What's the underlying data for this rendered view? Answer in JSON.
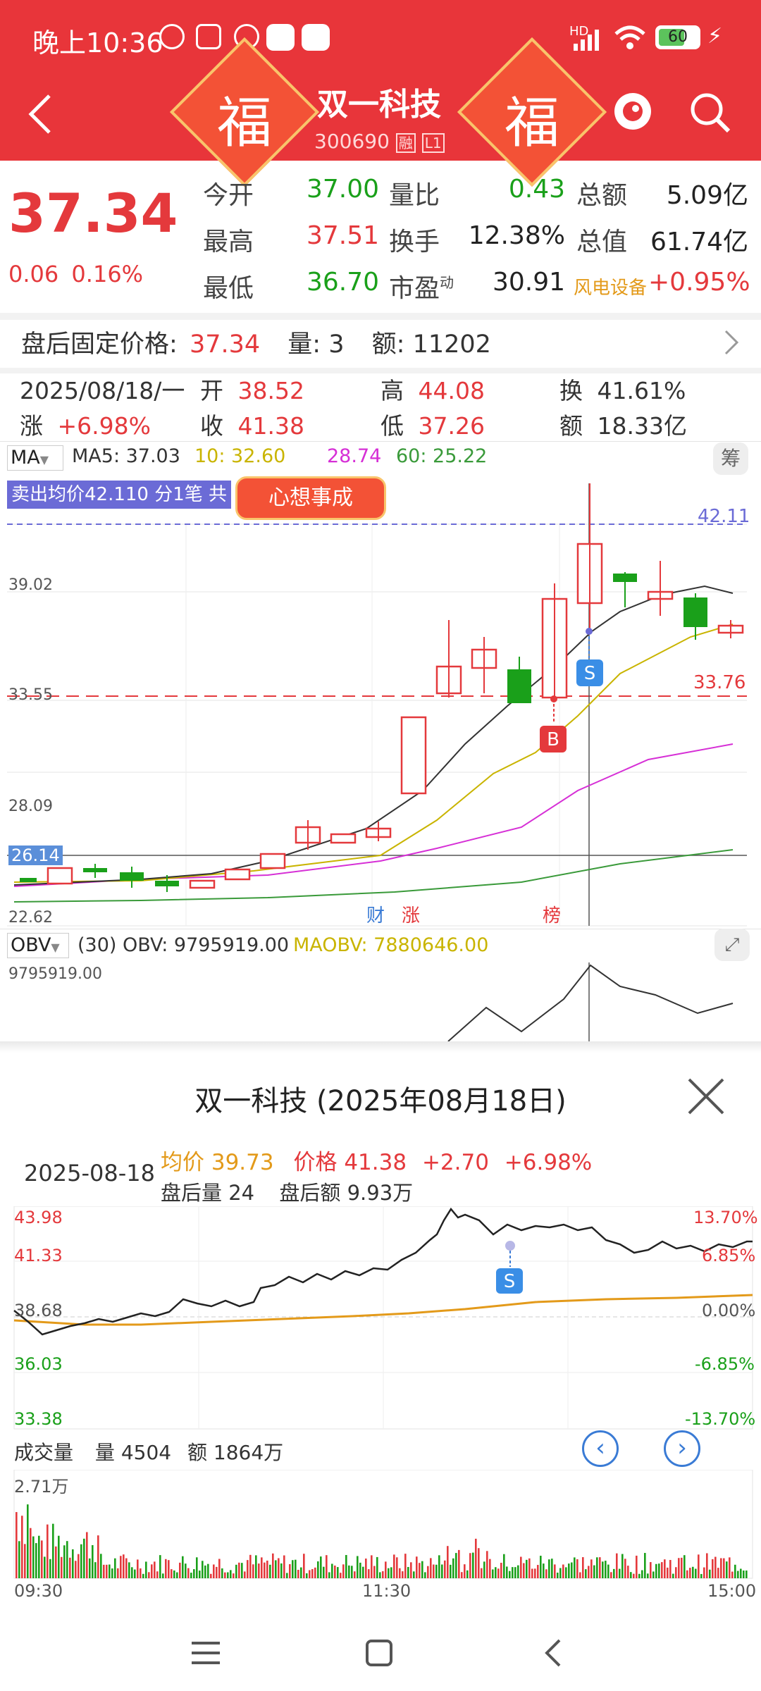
{
  "status_bar": {
    "time": "晚上10:36",
    "battery": "60",
    "network": "HD"
  },
  "nav": {
    "title": "双一科技",
    "code": "300690",
    "tag_rong": "融",
    "tag_level": "L1",
    "fu_char": "福"
  },
  "quote": {
    "price": "37.34",
    "change": "0.06",
    "change_pct": "0.16%",
    "items": [
      {
        "label": "今开",
        "value": "37.00"
      },
      {
        "label": "最高",
        "value": "37.51"
      },
      {
        "label": "最低",
        "value": "36.70"
      },
      {
        "label": "量比",
        "value": "0.43"
      },
      {
        "label": "换手",
        "value": "12.38%"
      },
      {
        "label": "市盈",
        "value": "30.91",
        "sup": "动"
      },
      {
        "label": "总额",
        "value": "5.09亿"
      },
      {
        "label": "总值",
        "value": "61.74亿"
      },
      {
        "label": "风电设备",
        "value": "+0.95%"
      }
    ]
  },
  "after_hours": {
    "label": "盘后固定价格:",
    "price": "37.34",
    "vol_label": "量:",
    "vol": "3",
    "amt_label": "额:",
    "amt": "11202"
  },
  "day_info": {
    "date": "2025/08/18/一",
    "open_label": "开",
    "open": "38.52",
    "high_label": "高",
    "high": "44.08",
    "turnover_label": "换",
    "turnover": "41.61%",
    "change_label": "涨",
    "change": "+6.98%",
    "close_label": "收",
    "close": "41.38",
    "low_label": "低",
    "low": "37.26",
    "amount_label": "额",
    "amount": "18.33亿"
  },
  "indicators": {
    "ma_selector": "MA",
    "ma5": "MA5: 37.03",
    "ma10": "10: 32.60",
    "ma30": "28.74",
    "ma60": "60: 25.22",
    "chip_button": "筹",
    "sell_avg": "卖出均价42.110 分1笔 共",
    "badge_text": "心想事成",
    "price_axis": [
      "42.11",
      "39.02",
      "33.55",
      "33.76",
      "28.09",
      "26.14",
      "22.62"
    ],
    "markers": {
      "buy": "B",
      "sell": "S",
      "cai": "财",
      "zhang": "涨",
      "bang": "榜"
    },
    "obv_selector": "OBV",
    "obv_text": "(30) OBV: 9795919.00",
    "maobv_text": "MAOBV: 7880646.00",
    "obv_axis": "9795919.00"
  },
  "colors": {
    "up": "#e4393c",
    "down": "#1aa01a",
    "header": "#e8353a",
    "ma5": "#333333",
    "ma10": "#c9b400",
    "ma30": "#d62fd6",
    "ma60": "#3a9a3a",
    "avg": "#e39a1a"
  },
  "sheet": {
    "title": "双一科技 (2025年08月18日)",
    "date": "2025-08-18",
    "avg_label": "均价",
    "avg": "39.73",
    "price_label": "价格",
    "price": "41.38",
    "change": "+2.70",
    "change_pct": "+6.98%",
    "after_vol_label": "盘后量",
    "after_vol": "24",
    "after_amt_label": "盘后额",
    "after_amt": "9.93万",
    "axis_left": [
      "43.98",
      "41.33",
      "38.68",
      "36.03",
      "33.38"
    ],
    "axis_right": [
      "13.70%",
      "6.85%",
      "0.00%",
      "-6.85%",
      "-13.70%"
    ],
    "sell_marker": "S",
    "vol_label": "成交量",
    "vol": "量 4504",
    "amt": "额 1864万",
    "vol_axis": "2.71万",
    "time_axis": [
      "09:30",
      "11:30",
      "15:00"
    ]
  }
}
